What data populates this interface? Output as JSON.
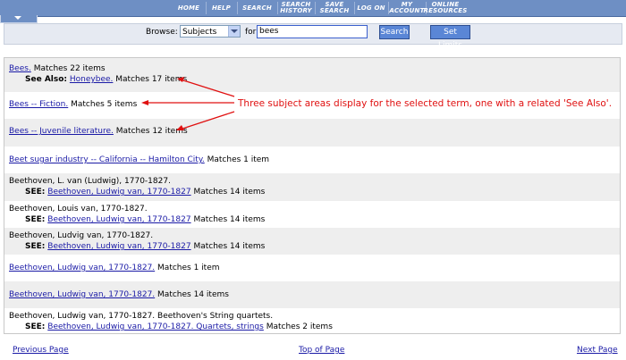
{
  "nav": {
    "home": "HOME",
    "help": "HELP",
    "search": "SEARCH",
    "search_history_1": "SEARCH",
    "search_history_2": "HISTORY",
    "save_search_1": "SAVE",
    "save_search_2": "SEARCH",
    "log_on": "LOG ON",
    "my_account_1": "MY",
    "my_account_2": "ACCOUNT",
    "online_resources_1": "ONLINE",
    "online_resources_2": "RESOURCES"
  },
  "browse": {
    "label": "Browse:",
    "selected": "Subjects",
    "for_label": "for",
    "query": "bees",
    "search_button": "Search",
    "limits_button": "Set Limits"
  },
  "results": [
    {
      "heading": "Bees.",
      "matches": "Matches 22 items",
      "see_also_label": "See Also:",
      "see_also_link": "Honeybee.",
      "see_also_matches": "Matches 17 items"
    },
    {
      "heading": "Bees -- Fiction.",
      "matches": "Matches 5 items"
    },
    {
      "heading": "Bees -- Juvenile literature.",
      "matches": "Matches 12 items"
    },
    {
      "heading": "Beet sugar industry -- California -- Hamilton City.",
      "matches": "Matches 1 item"
    },
    {
      "text": "Beethoven, L. van (Ludwig), 1770-1827.",
      "see_label": "SEE:",
      "see_link": "Beethoven, Ludwig van, 1770-1827",
      "see_matches": "Matches 14 items"
    },
    {
      "text": "Beethoven, Louis van, 1770-1827.",
      "see_label": "SEE:",
      "see_link": "Beethoven, Ludwig van, 1770-1827",
      "see_matches": "Matches 14 items"
    },
    {
      "text": "Beethoven, Ludvig van, 1770-1827.",
      "see_label": "SEE:",
      "see_link": "Beethoven, Ludwig van, 1770-1827",
      "see_matches": "Matches 14 items"
    },
    {
      "heading": "Beethoven, Ludwig van, 1770-1827.",
      "matches": "Matches 1 item"
    },
    {
      "heading": "Beethoven, Ludwig van, 1770-1827.",
      "matches": "Matches 14 items"
    },
    {
      "text": "Beethoven, Ludwig van, 1770-1827. Beethoven's String quartets.",
      "see_label": "SEE:",
      "see_link": "Beethoven, Ludwig van, 1770-1827. Quartets, strings",
      "see_matches": "Matches 2 items"
    }
  ],
  "annotation": "Three subject areas display for the selected term, one with a related 'See Also'.",
  "footer": {
    "previous": "Previous Page",
    "top": "Top of Page",
    "next": "Next Page"
  },
  "colors": {
    "nav_bar": "#6e8fc4",
    "link": "#1a1aa6",
    "annotation": "#e01010",
    "button": "#5a86d6"
  }
}
